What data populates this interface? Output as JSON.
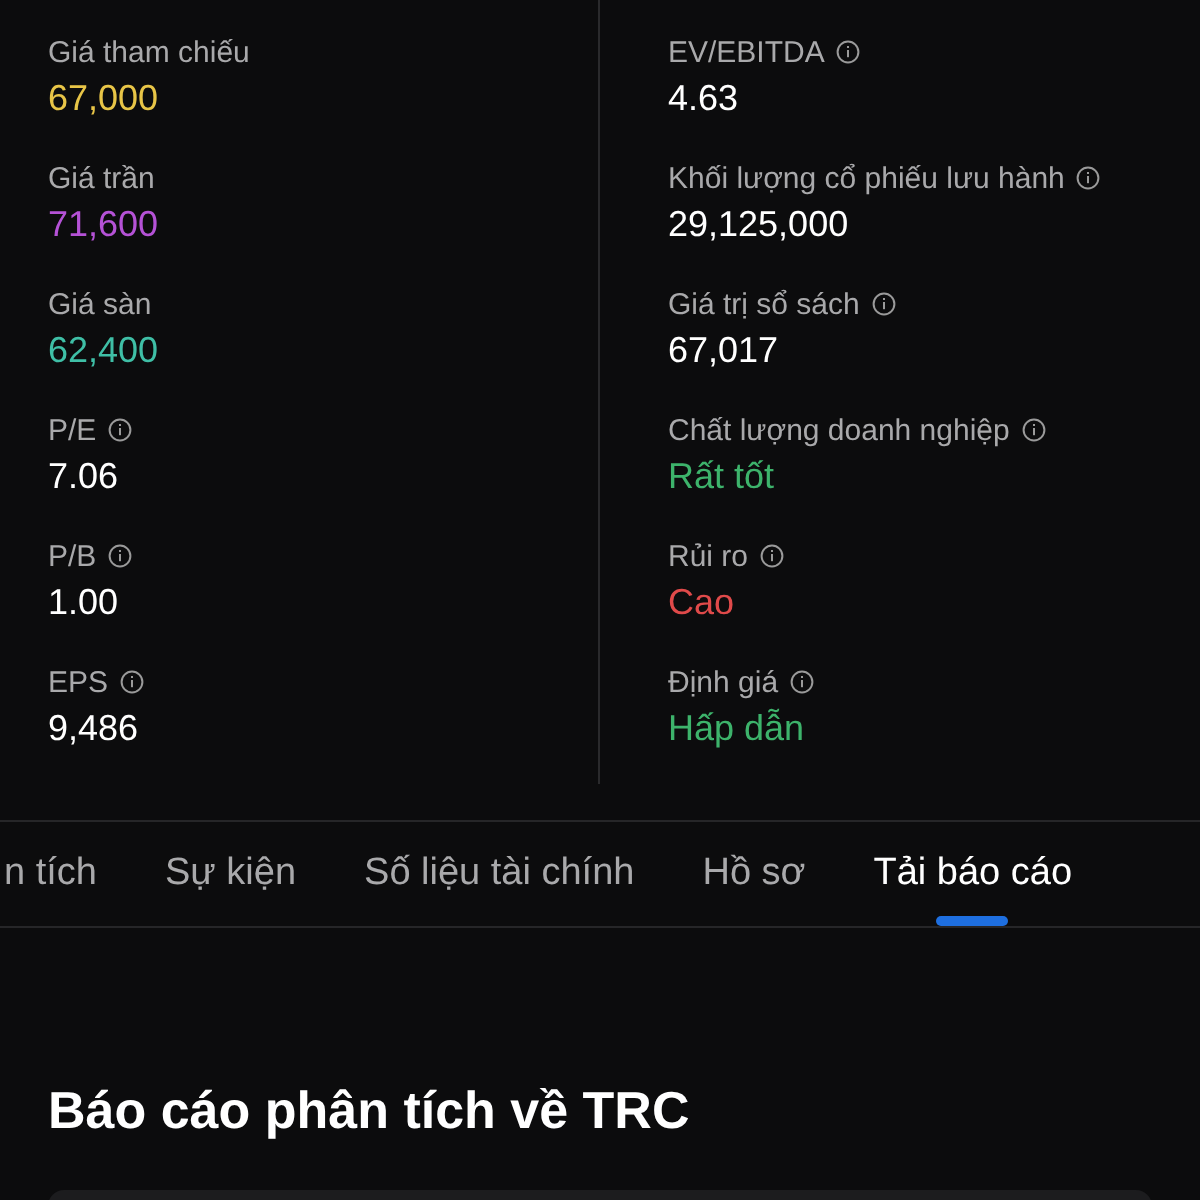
{
  "metrics_left": [
    {
      "label": "Giá tham chiếu",
      "value": "67,000",
      "info": false,
      "color": "#e8c547"
    },
    {
      "label": "Giá trần",
      "value": "71,600",
      "info": false,
      "color": "#b552d6"
    },
    {
      "label": "Giá sàn",
      "value": "62,400",
      "info": false,
      "color": "#3fbfa6"
    },
    {
      "label": "P/E",
      "value": "7.06",
      "info": true,
      "color": "#ffffff"
    },
    {
      "label": "P/B",
      "value": "1.00",
      "info": true,
      "color": "#ffffff"
    },
    {
      "label": "EPS",
      "value": "9,486",
      "info": true,
      "color": "#ffffff"
    }
  ],
  "metrics_right": [
    {
      "label": "EV/EBITDA",
      "value": "4.63",
      "info": true,
      "color": "#ffffff"
    },
    {
      "label": "Khối lượng cổ phiếu lưu hành",
      "value": "29,125,000",
      "info": true,
      "color": "#ffffff"
    },
    {
      "label": "Giá trị sổ sách",
      "value": "67,017",
      "info": true,
      "color": "#ffffff"
    },
    {
      "label": "Chất lượng doanh nghiệp",
      "value": "Rất tốt",
      "info": true,
      "color": "#3db36b"
    },
    {
      "label": "Rủi ro",
      "value": "Cao",
      "info": true,
      "color": "#e04a4a"
    },
    {
      "label": "Định giá",
      "value": "Hấp dẫn",
      "info": true,
      "color": "#3db36b"
    }
  ],
  "tabs": [
    {
      "label": "n tích",
      "selected": false
    },
    {
      "label": "Sự kiện",
      "selected": false
    },
    {
      "label": "Số liệu tài chính",
      "selected": false
    },
    {
      "label": "Hồ sơ",
      "selected": false
    },
    {
      "label": "Tải báo cáo",
      "selected": true
    }
  ],
  "section_title": "Báo cáo phân tích về TRC"
}
